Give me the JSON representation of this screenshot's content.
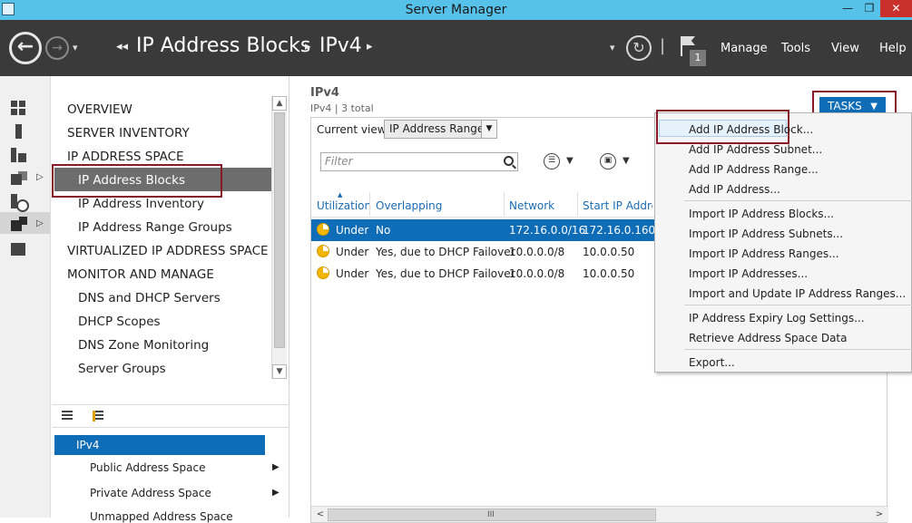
{
  "window": {
    "title": "Server Manager",
    "min_glyph": "—",
    "max_glyph": "❐",
    "close_glyph": "✕"
  },
  "header": {
    "back_glyph": "←",
    "forward_glyph": "→",
    "history_glyph": "▾",
    "breadcrumb_lead": "◂◂",
    "breadcrumb": [
      "IP Address Blocks",
      "IPv4"
    ],
    "breadcrumb_sep": "▸",
    "drop_glyph": "▾",
    "refresh_glyph": "↻",
    "pipe": "|",
    "notification_count": "1",
    "menus": {
      "manage": "Manage",
      "tools": "Tools",
      "view": "View",
      "help": "Help"
    }
  },
  "rail": {
    "icons": [
      "dashboard-icon",
      "local-server-icon",
      "all-servers-icon",
      "file-storage-icon",
      "iis-icon",
      "ipam-icon",
      "reports-icon"
    ],
    "arrow_glyph": "▷"
  },
  "nav": {
    "overview": "OVERVIEW",
    "server_inventory": "SERVER INVENTORY",
    "ip_address_space": "IP ADDRESS SPACE",
    "ip_address_blocks": "IP Address Blocks",
    "ip_address_inventory": "IP Address Inventory",
    "ip_address_range_groups": "IP Address Range Groups",
    "virtualized_ip_address_space": "VIRTUALIZED IP ADDRESS SPACE",
    "monitor_and_manage": "MONITOR AND MANAGE",
    "dns_dhcp_servers": "DNS and DHCP Servers",
    "dhcp_scopes": "DHCP Scopes",
    "dns_zone_monitoring": "DNS Zone Monitoring",
    "server_groups": "Server Groups",
    "scroll_up": "▲",
    "scroll_down": "▼"
  },
  "tree": {
    "selected": "IPv4",
    "items": [
      "Public Address Space",
      "Private Address Space",
      "Unmapped Address Space"
    ],
    "arrow_glyph": "▶"
  },
  "main": {
    "title": "IPv4",
    "subtitle": "IPv4 | 3 total",
    "tasks_label": "TASKS",
    "tasks_caret": "▼",
    "current_view_label": "Current view:",
    "current_view_value": "IP Address Ranges",
    "select_caret": "▼",
    "filter_placeholder": "Filter",
    "options_glyph": "☰",
    "save_glyph": "▣",
    "options_caret": "▼",
    "sort_glyph": "▲",
    "columns": [
      "Utilization",
      "Overlapping",
      "Network",
      "Start IP Address"
    ],
    "rows": [
      {
        "utilization": "Under",
        "overlapping": "No",
        "network": "172.16.0.0/16",
        "start_ip": "172.16.0.160",
        "selected": true
      },
      {
        "utilization": "Under",
        "overlapping": "Yes, due to DHCP Failover",
        "network": "10.0.0.0/8",
        "start_ip": "10.0.0.50",
        "selected": false
      },
      {
        "utilization": "Under",
        "overlapping": "Yes, due to DHCP Failover",
        "network": "10.0.0.0/8",
        "start_ip": "10.0.0.50",
        "selected": false
      }
    ],
    "hscroll": {
      "left": "<",
      "right": ">",
      "grip": "III"
    }
  },
  "tasks_menu": {
    "groups": [
      [
        "Add IP Address Block...",
        "Add IP Address Subnet...",
        "Add IP Address Range...",
        "Add IP Address..."
      ],
      [
        "Import IP Address Blocks...",
        "Import IP Address Subnets...",
        "Import IP Address Ranges...",
        "Import IP Addresses...",
        "Import and Update IP Address Ranges..."
      ],
      [
        "IP Address Expiry Log Settings...",
        "Retrieve Address Space Data"
      ],
      [
        "Export..."
      ]
    ]
  },
  "colors": {
    "titlebar": "#56c2ea",
    "header": "#3a3a3a",
    "accent": "#0f6cb6",
    "highlight_frame": "#8b1a28",
    "nav_selected": "#6d6d6d",
    "utilization_under": "#f2b500"
  }
}
